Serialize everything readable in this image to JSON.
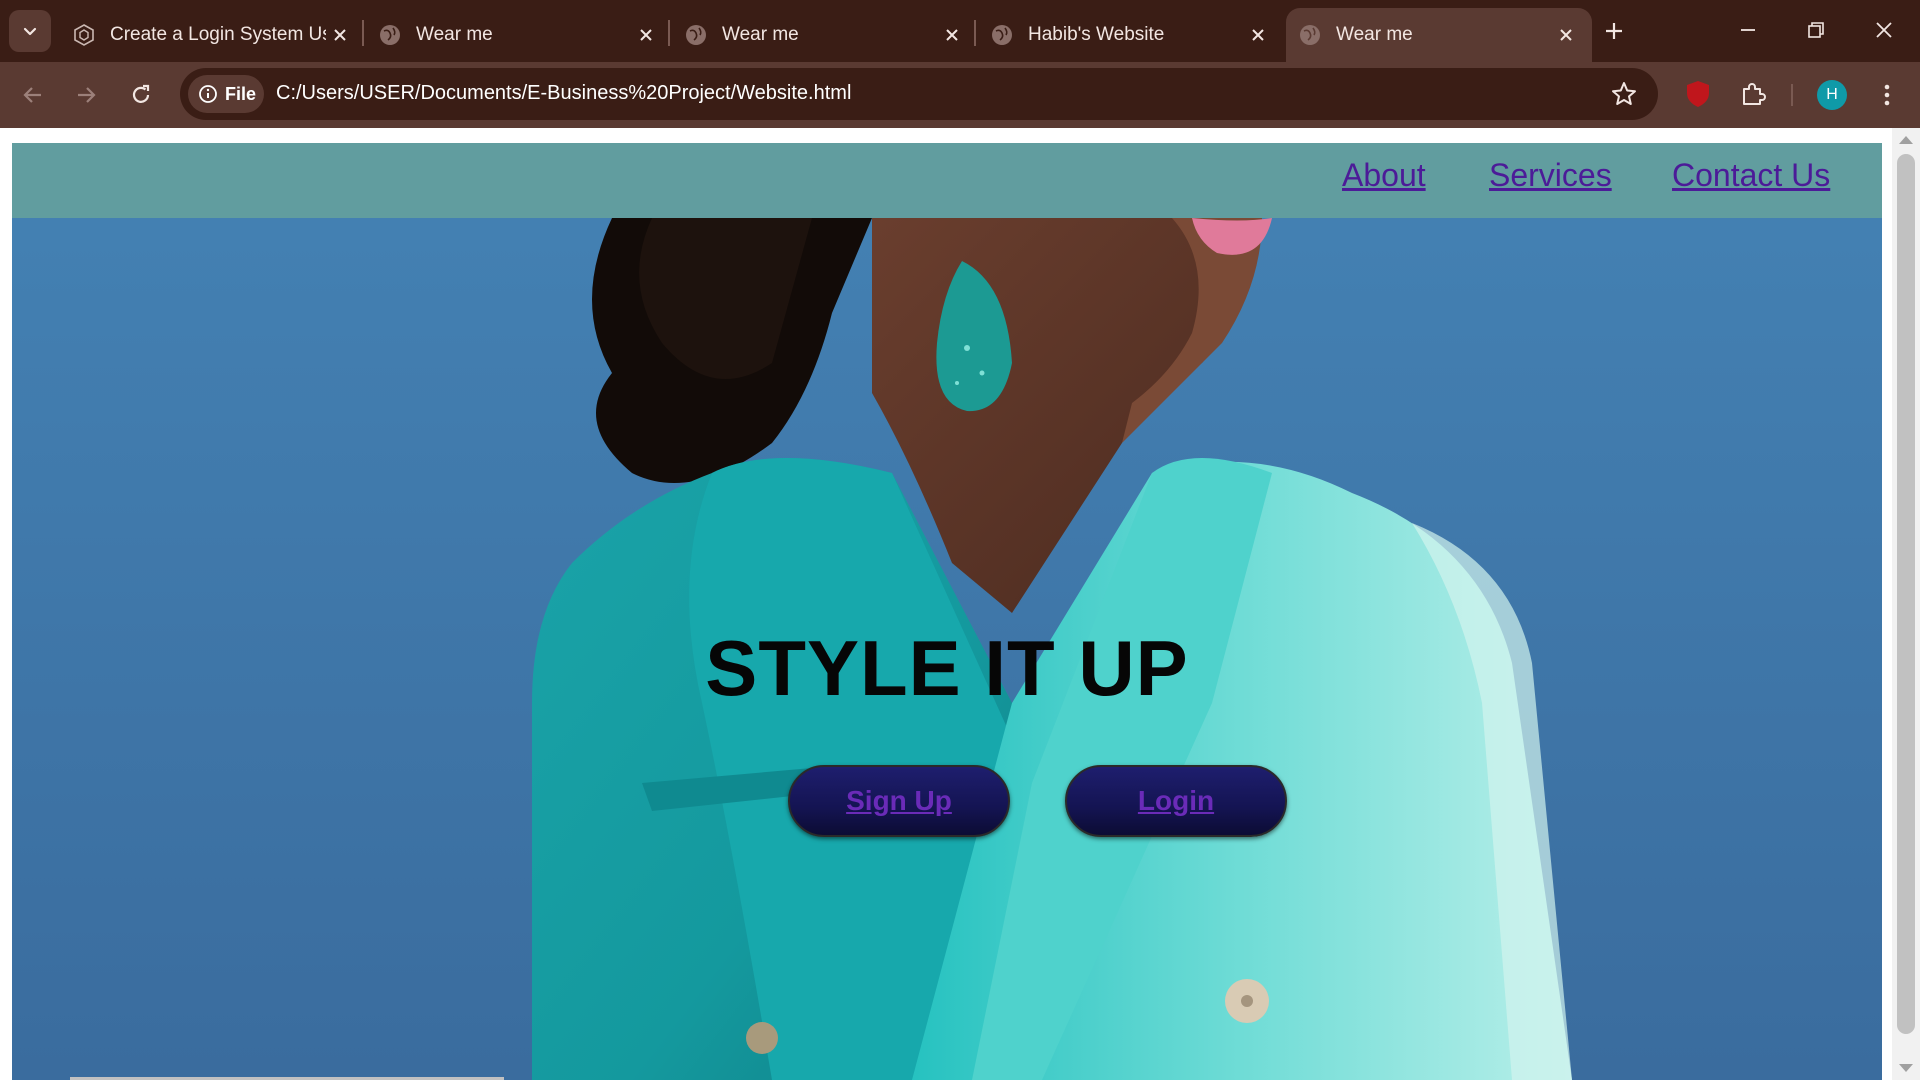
{
  "browser": {
    "tabs": [
      {
        "title": "Create a Login System Us",
        "icon": "codepen-icon",
        "active": false
      },
      {
        "title": "Wear me",
        "icon": "globe-icon",
        "active": false
      },
      {
        "title": "Wear me",
        "icon": "globe-icon",
        "active": false
      },
      {
        "title": "Habib's Website",
        "icon": "globe-icon",
        "active": false
      },
      {
        "title": "Wear me",
        "icon": "globe-icon",
        "active": true
      }
    ],
    "site_chip_label": "File",
    "url": "C:/Users/USER/Documents/E-Business%20Project/Website.html",
    "profile_initial": "H",
    "ublock_label": "uO",
    "colors": {
      "frame": "#3a1d15",
      "toolbar": "#5a3a32",
      "profile": "#0f9aa8",
      "ublock": "#c0161c"
    }
  },
  "site": {
    "nav": {
      "links": [
        "About",
        "Services",
        "Contact Us"
      ],
      "background": "#619d9f",
      "link_color": "#4c1b98"
    },
    "hero": {
      "title": "STYLE IT UP",
      "buttons": {
        "signup": "Sign Up",
        "login": "Login"
      },
      "image_description_icon": "woman-in-teal-blazer-photo"
    }
  }
}
